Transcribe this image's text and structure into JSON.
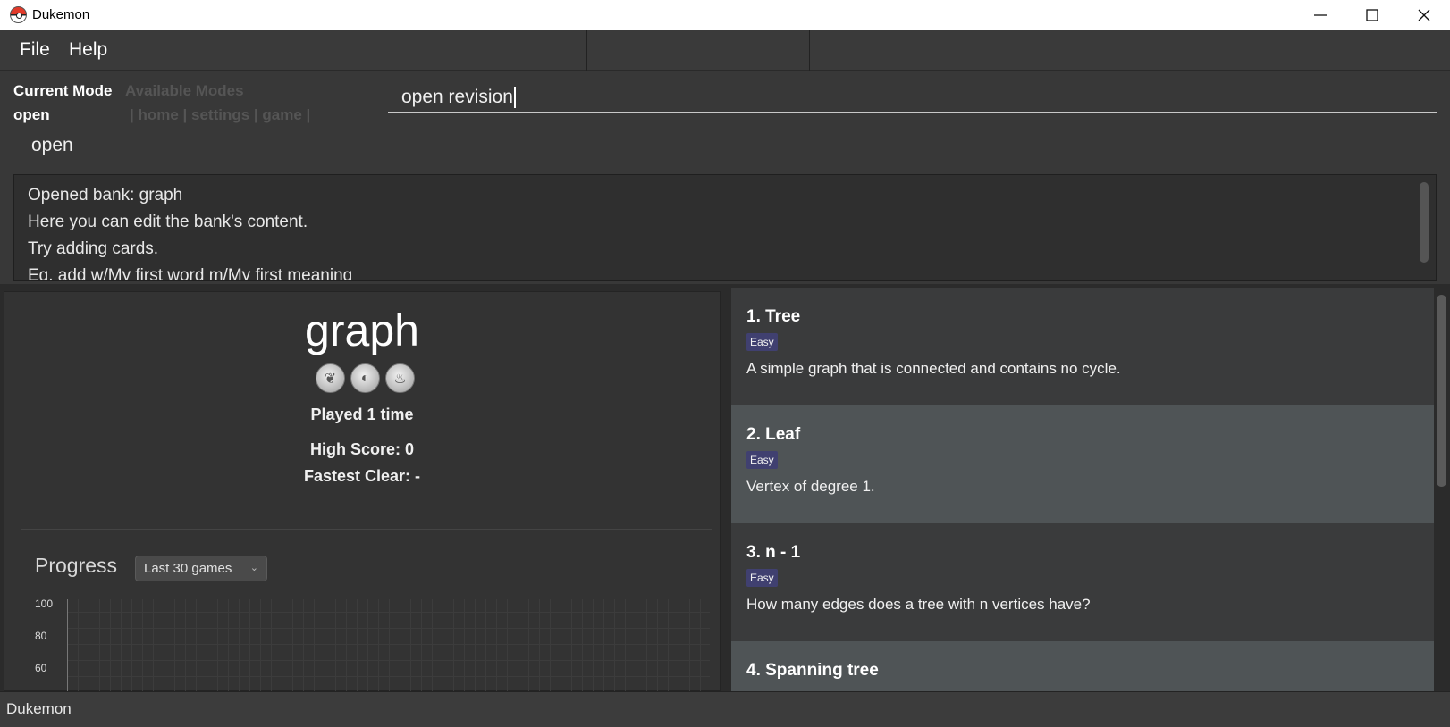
{
  "window": {
    "title": "Dukemon",
    "controls": [
      "minimize",
      "maximize",
      "close"
    ]
  },
  "menu": {
    "items": [
      "File",
      "Help"
    ]
  },
  "mode_panel": {
    "current_mode_label": "Current Mode",
    "current_mode_value": "open",
    "available_modes_label": "Available Modes",
    "available_modes_value": "| home | settings | game |"
  },
  "command_box": {
    "value": "open revision",
    "suggestion": "open"
  },
  "result_display": {
    "lines": [
      "Opened bank: graph",
      "Here you can edit the bank's content.",
      "Try adding cards.",
      "Eg. add w/My first word m/My first meaning"
    ]
  },
  "bank": {
    "title": "graph",
    "badge_icons": [
      "grass-badge-icon",
      "water-badge-icon",
      "fire-badge-icon"
    ],
    "played": "Played 1 time",
    "high_score": "High Score: 0",
    "fastest_clear": "Fastest Clear:  -"
  },
  "progress": {
    "label": "Progress",
    "range_select": "Last 30 games",
    "y_ticks": [
      "100",
      "80",
      "60"
    ]
  },
  "cards": [
    {
      "title": "1.  Tree",
      "difficulty": "Easy",
      "meaning": "A simple graph that is connected and contains no cycle."
    },
    {
      "title": "2.  Leaf",
      "difficulty": "Easy",
      "meaning": "Vertex of degree 1."
    },
    {
      "title": "3.  n - 1",
      "difficulty": "Easy",
      "meaning": "How many edges does a tree with n vertices have?"
    },
    {
      "title": "4.  Spanning tree",
      "difficulty": "",
      "meaning": ""
    }
  ],
  "status_bar": {
    "text": "Dukemon"
  },
  "colors": {
    "background": "#2b2b2b",
    "panel": "#383838",
    "card_dark": "#3a3b3c",
    "card_light": "#4f5456",
    "tag": "#404070"
  }
}
